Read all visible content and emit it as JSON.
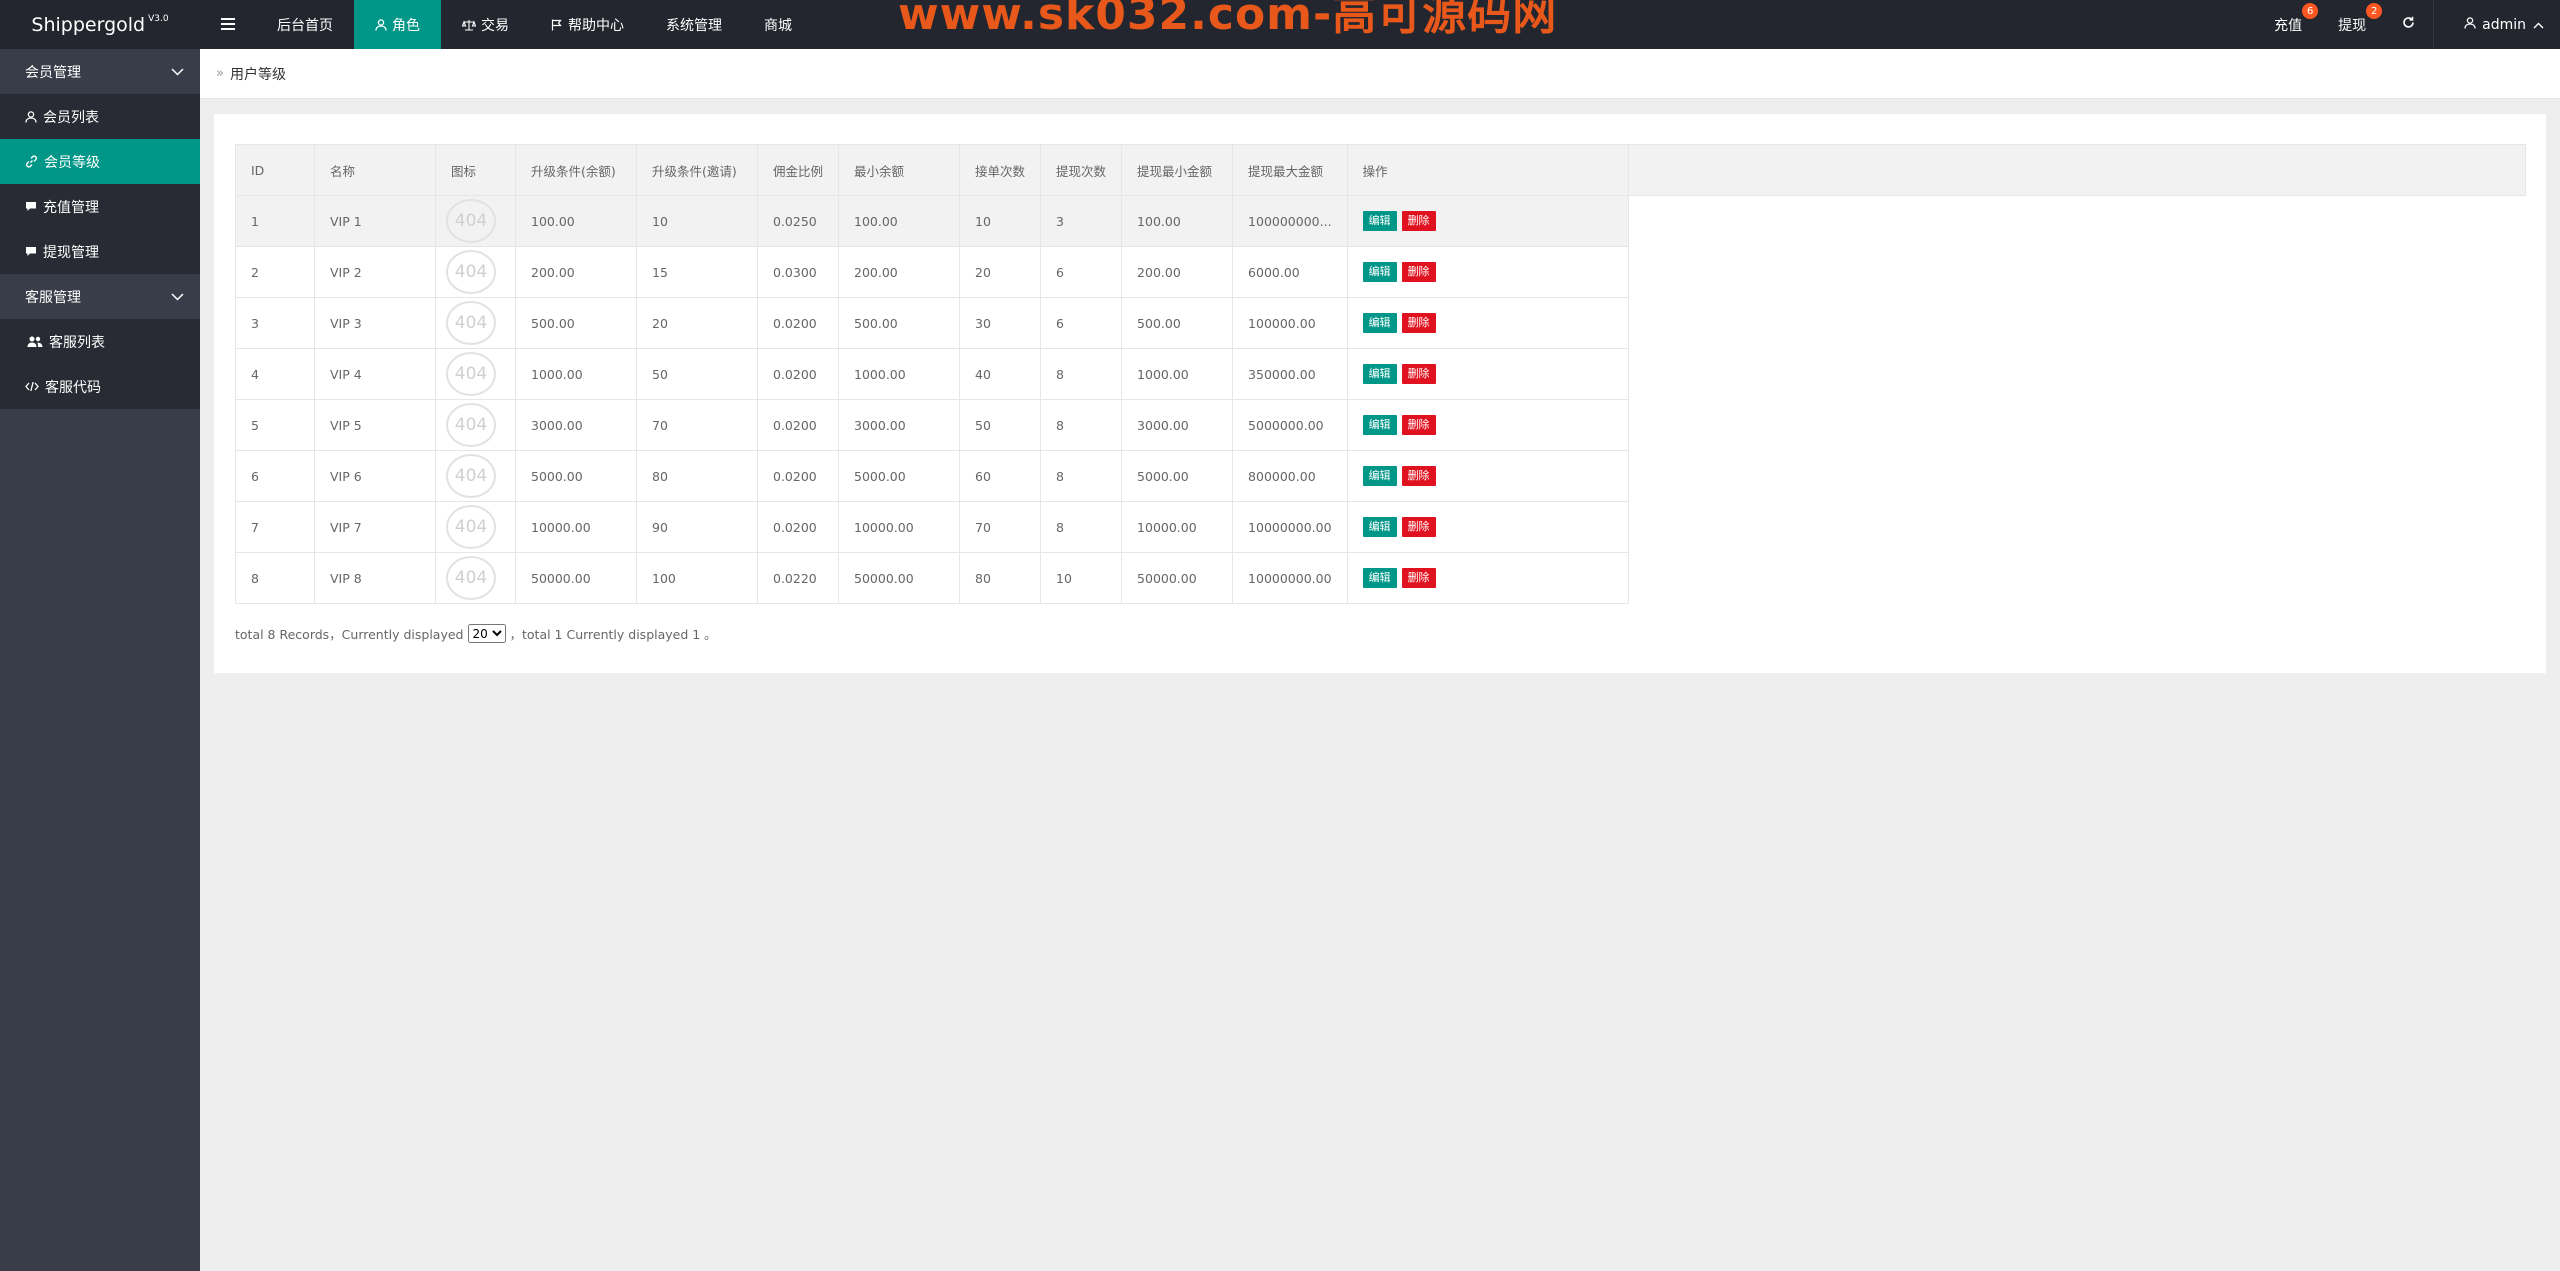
{
  "app": {
    "name": "Shippergold",
    "version": "V3.0"
  },
  "watermark": "www.sk032.com-高可源码网",
  "topnav": {
    "items": [
      {
        "label": "后台首页",
        "icon": "",
        "active": false
      },
      {
        "label": "角色",
        "icon": "user-icon",
        "active": true
      },
      {
        "label": "交易",
        "icon": "scale-icon",
        "active": false
      },
      {
        "label": "帮助中心",
        "icon": "flag-icon",
        "active": false
      },
      {
        "label": "系统管理",
        "icon": "",
        "active": false
      },
      {
        "label": "商城",
        "icon": "",
        "active": false
      }
    ],
    "menu_toggle_icon": "menu-icon"
  },
  "rightnav": {
    "recharge": {
      "label": "充值",
      "badge": "6"
    },
    "withdraw": {
      "label": "提现",
      "badge": "2"
    },
    "refresh_icon": "refresh-icon",
    "user": {
      "name": "admin",
      "icon": "user-icon",
      "chevron_icon": "chevron-up-icon"
    }
  },
  "sidebar": {
    "groups": [
      {
        "label": "会员管理",
        "items": [
          {
            "label": "会员列表",
            "icon": "user-icon",
            "active": false
          },
          {
            "label": "会员等级",
            "icon": "link-icon",
            "active": true
          },
          {
            "label": "充值管理",
            "icon": "comment-icon",
            "active": false
          },
          {
            "label": "提现管理",
            "icon": "comment-icon",
            "active": false
          }
        ]
      },
      {
        "label": "客服管理",
        "items": [
          {
            "label": "客服列表",
            "icon": "users-icon",
            "active": false
          },
          {
            "label": "客服代码",
            "icon": "code-icon",
            "active": false
          }
        ]
      }
    ]
  },
  "breadcrumb": {
    "current": "用户等级"
  },
  "table": {
    "columns": [
      "ID",
      "名称",
      "图标",
      "升级条件(余额)",
      "升级条件(邀请)",
      "佣金比例",
      "最小余额",
      "接单次数",
      "提现次数",
      "提现最小金额",
      "提现最大金额",
      "操作"
    ],
    "image_placeholder": "404",
    "edit_label": "编辑",
    "delete_label": "删除",
    "rows": [
      {
        "id": "1",
        "name": "VIP 1",
        "balance": "100.00",
        "invite": "10",
        "rate": "0.0250",
        "min_balance": "100.00",
        "orders": "10",
        "withdraw_times": "3",
        "withdraw_min": "100.00",
        "withdraw_max": "100000000..."
      },
      {
        "id": "2",
        "name": "VIP 2",
        "balance": "200.00",
        "invite": "15",
        "rate": "0.0300",
        "min_balance": "200.00",
        "orders": "20",
        "withdraw_times": "6",
        "withdraw_min": "200.00",
        "withdraw_max": "6000.00"
      },
      {
        "id": "3",
        "name": "VIP 3",
        "balance": "500.00",
        "invite": "20",
        "rate": "0.0200",
        "min_balance": "500.00",
        "orders": "30",
        "withdraw_times": "6",
        "withdraw_min": "500.00",
        "withdraw_max": "100000.00"
      },
      {
        "id": "4",
        "name": "VIP 4",
        "balance": "1000.00",
        "invite": "50",
        "rate": "0.0200",
        "min_balance": "1000.00",
        "orders": "40",
        "withdraw_times": "8",
        "withdraw_min": "1000.00",
        "withdraw_max": "350000.00"
      },
      {
        "id": "5",
        "name": "VIP 5",
        "balance": "3000.00",
        "invite": "70",
        "rate": "0.0200",
        "min_balance": "3000.00",
        "orders": "50",
        "withdraw_times": "8",
        "withdraw_min": "3000.00",
        "withdraw_max": "5000000.00"
      },
      {
        "id": "6",
        "name": "VIP 6",
        "balance": "5000.00",
        "invite": "80",
        "rate": "0.0200",
        "min_balance": "5000.00",
        "orders": "60",
        "withdraw_times": "8",
        "withdraw_min": "5000.00",
        "withdraw_max": "800000.00"
      },
      {
        "id": "7",
        "name": "VIP 7",
        "balance": "10000.00",
        "invite": "90",
        "rate": "0.0200",
        "min_balance": "10000.00",
        "orders": "70",
        "withdraw_times": "8",
        "withdraw_min": "10000.00",
        "withdraw_max": "10000000.00"
      },
      {
        "id": "8",
        "name": "VIP 8",
        "balance": "50000.00",
        "invite": "100",
        "rate": "0.0220",
        "min_balance": "50000.00",
        "orders": "80",
        "withdraw_times": "10",
        "withdraw_min": "50000.00",
        "withdraw_max": "10000000.00"
      }
    ]
  },
  "pager": {
    "prefix": "total 8 Records，Currently displayed",
    "page_size": "20",
    "suffix": "，total 1 Currently displayed 1 。"
  },
  "colors": {
    "accent": "#009688",
    "danger": "#e0121f",
    "header_bg": "#23262e",
    "sidebar_bg": "#393d49",
    "badge": "#ff5722",
    "watermark": "#e8581b"
  }
}
